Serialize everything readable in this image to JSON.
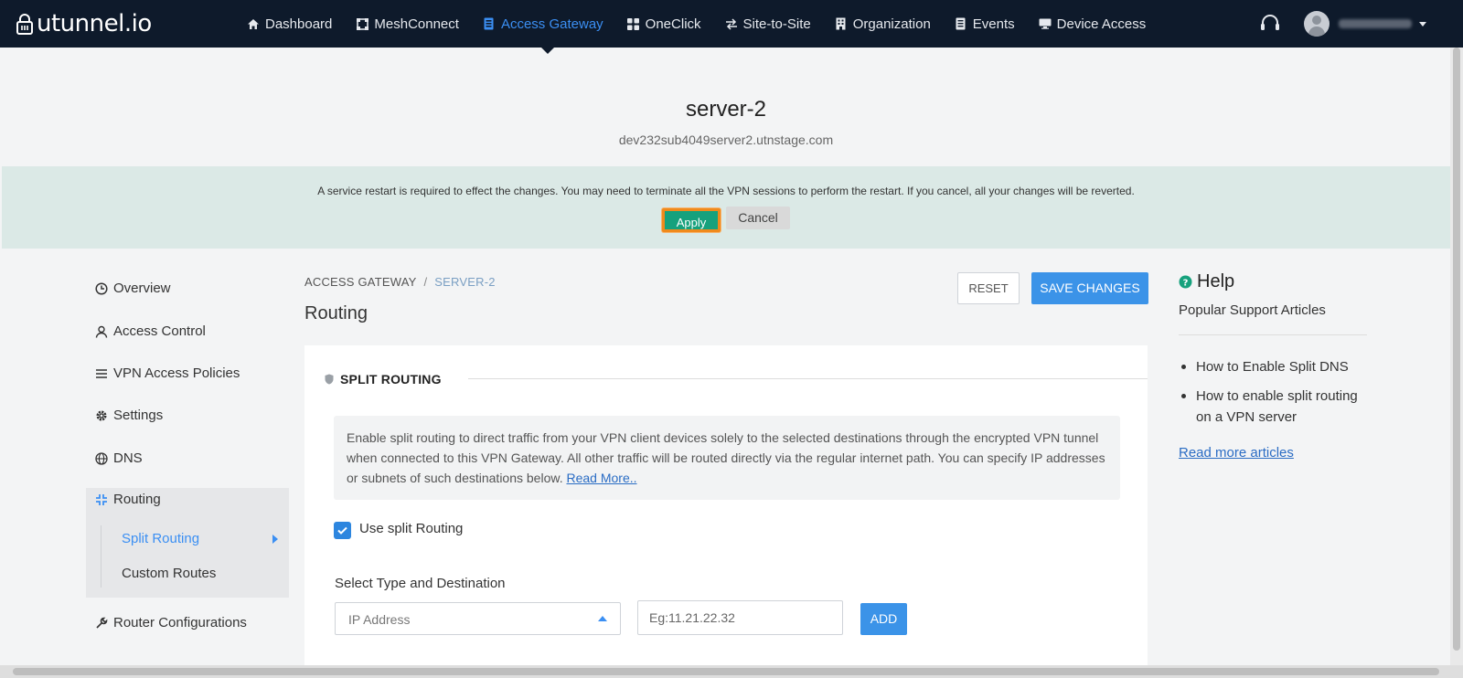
{
  "brand": {
    "name": "utunnel.io"
  },
  "nav": {
    "items": [
      {
        "label": "Dashboard",
        "icon": "home-icon"
      },
      {
        "label": "MeshConnect",
        "icon": "mesh-icon"
      },
      {
        "label": "Access Gateway",
        "icon": "gateway-icon",
        "active": true
      },
      {
        "label": "OneClick",
        "icon": "grid-icon"
      },
      {
        "label": "Site-to-Site",
        "icon": "arrows-icon"
      },
      {
        "label": "Organization",
        "icon": "building-icon"
      },
      {
        "label": "Events",
        "icon": "list-icon"
      },
      {
        "label": "Device Access",
        "icon": "monitor-icon"
      }
    ],
    "support_icon": "headset-icon"
  },
  "server": {
    "name": "server-2",
    "host": "dev232sub4049server2.utnstage.com"
  },
  "notice": {
    "text": "A service restart is required to effect the changes. You may need to terminate all the VPN sessions to perform the restart. If you cancel, all your changes will be reverted.",
    "apply_label": "Apply",
    "cancel_label": "Cancel"
  },
  "sidebar": {
    "items": [
      {
        "label": "Overview",
        "icon": "clock-icon"
      },
      {
        "label": "Access Control",
        "icon": "user-icon"
      },
      {
        "label": "VPN Access Policies",
        "icon": "list-icon"
      },
      {
        "label": "Settings",
        "icon": "gear-icon"
      },
      {
        "label": "DNS",
        "icon": "globe-icon"
      },
      {
        "label": "Routing",
        "icon": "routing-icon",
        "active": true
      },
      {
        "label": "Router Configurations",
        "icon": "wrench-icon"
      }
    ],
    "routing_sub": [
      {
        "label": "Split Routing",
        "active": true
      },
      {
        "label": "Custom Routes"
      }
    ]
  },
  "breadcrumb": {
    "root": "ACCESS GATEWAY",
    "separator": "/",
    "current": "SERVER-2"
  },
  "page": {
    "title": "Routing"
  },
  "actions": {
    "reset_label": "RESET",
    "save_label": "SAVE CHANGES"
  },
  "split_routing": {
    "heading": "SPLIT ROUTING",
    "description": "Enable split routing to direct traffic from your VPN client devices solely to the selected destinations through the encrypted VPN tunnel when connected to this VPN Gateway. All other traffic will be routed directly via the regular internet path. You can specify IP addresses or subnets of such destinations below.",
    "read_more": "Read More..",
    "checkbox_label": "Use split Routing",
    "checked": true,
    "destination_label": "Select Type and Destination",
    "type_value": "IP Address",
    "ip_placeholder": "Eg:11.21.22.32",
    "add_label": "ADD"
  },
  "help": {
    "title": "Help",
    "subtitle": "Popular Support Articles",
    "articles": [
      "How to Enable Split DNS",
      "How to enable split routing on a VPN server"
    ],
    "more": "Read more articles"
  },
  "colors": {
    "nav_bg": "#0e1a2b",
    "accent": "#3b8ff3",
    "apply": "#16a17d",
    "apply_outline": "#f08a1c",
    "notice_bg": "#dbe9e6"
  }
}
